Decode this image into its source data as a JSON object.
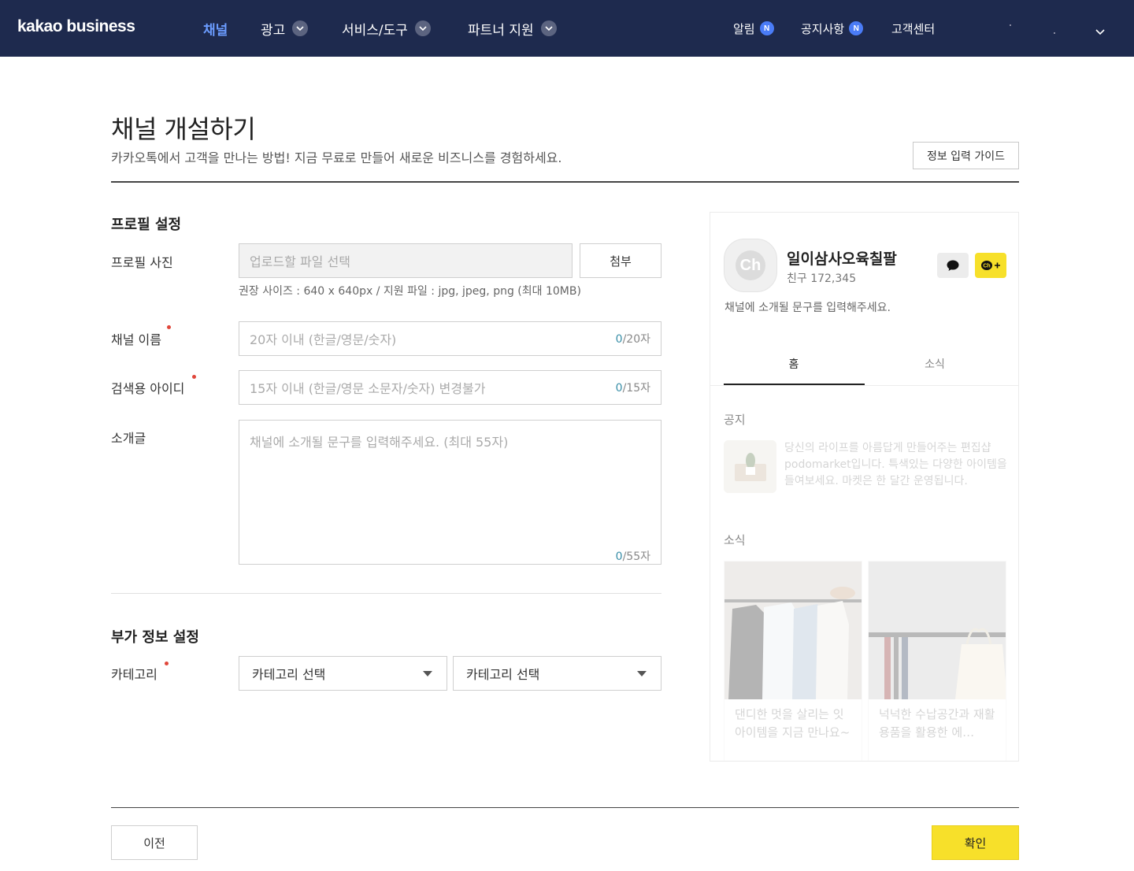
{
  "header": {
    "logo": "kakao business",
    "nav": [
      {
        "label": "채널"
      },
      {
        "label": "광고"
      },
      {
        "label": "서비스/도구"
      },
      {
        "label": "파트너 지원"
      }
    ],
    "right": {
      "alerts": "알림",
      "notices": "공지사항",
      "badge": "N",
      "support": "고객센터"
    }
  },
  "page": {
    "title": "채널 개설하기",
    "subtitle": "카카오톡에서 고객을 만나는 방법! 지금 무료로 만들어 새로운 비즈니스를 경험하세요.",
    "guide_button": "정보 입력 가이드"
  },
  "profile_section": {
    "title": "프로필 설정",
    "photo": {
      "label": "프로필 사진",
      "placeholder": "업로드할 파일 선택",
      "attach_button": "첨부",
      "hint": "권장 사이즈 : 640 x 640px / 지원 파일 : jpg, jpeg, png (최대 10MB)"
    },
    "channel_name": {
      "label": "채널 이름",
      "placeholder": "20자 이내 (한글/영문/숫자)",
      "count": "0",
      "max": "/20자"
    },
    "search_id": {
      "label": "검색용 아이디",
      "placeholder": "15자 이내 (한글/영문 소문자/숫자) 변경불가",
      "count": "0",
      "max": "/15자"
    },
    "intro": {
      "label": "소개글",
      "placeholder": "채널에 소개될 문구를 입력해주세요. (최대 55자)",
      "count": "0",
      "max": "/55자"
    }
  },
  "extra_section": {
    "title": "부가 정보 설정",
    "category_label": "카테고리",
    "select1": "카테고리 선택",
    "select2": "카테고리 선택"
  },
  "preview": {
    "avatar_text": "Ch",
    "name": "일이삼사오육칠팔",
    "friends": "친구 172,345",
    "description": "채널에 소개될 문구를 입력해주세요.",
    "tab_home": "홈",
    "tab_news": "소식",
    "notice_label": "공지",
    "notice_text": "당신의 라이프를 아름답게 만들어주는 편집샵 podomarket입니다. 특색있는 다양한 아이템을 들여보세요. 마켓은 한 달간 운영됩니다.",
    "news_label": "소식",
    "cards": [
      {
        "text": "댄디한 멋을 살리는 잇 아이템을 지금 만나요~"
      },
      {
        "text": "넉넉한 수납공간과 재활용품을 활용한 에…"
      }
    ]
  },
  "footer": {
    "prev": "이전",
    "confirm": "확인"
  },
  "colors": {
    "header_bg": "#1e2a4e",
    "active_nav": "#6b9cff",
    "badge": "#4a7cf7",
    "required": "#e0463a",
    "confirm": "#f7e02a"
  }
}
